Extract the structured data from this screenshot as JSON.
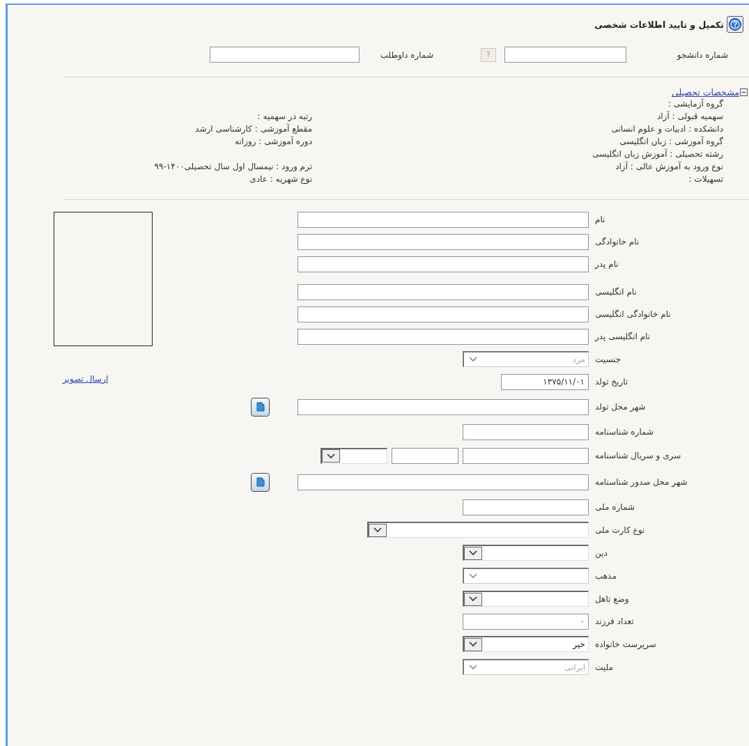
{
  "header": {
    "title": "تکمیل و تایید اطلاعات شخصی"
  },
  "id_fields": [
    {
      "label": "شماره دانشجو",
      "help": "?"
    },
    {
      "label": "شماره داوطلب"
    }
  ],
  "academic": {
    "title": "مشخصات تحصیلی",
    "expanded": true,
    "rows": [
      {
        "right": "گروه آزمایشی :"
      },
      {
        "right": "سهمیه قبولی : آزاد",
        "left": "رتبه در سهمیه :"
      },
      {
        "right": "دانشکده : ادبیات و علوم انسانی",
        "left": "مقطع آموزشی : کارشناسی ارشد"
      },
      {
        "right": "گروه آموزشی : زبان انگلیسی",
        "left": "دوره آموزشی : روزانه"
      },
      {
        "right": "رشته تحصیلی : آموزش زبان انگلیسی"
      },
      {
        "right": "نوع ورود به آموزش عالی : آزاد",
        "left": "ترم ورود : نیمسال اول سال تحصیلی۱۴۰۰-۹۹"
      },
      {
        "right": "تسهیلات :",
        "left": "نوع شهریه : عادی"
      }
    ]
  },
  "photo": {
    "link": "ارسال تصویر"
  },
  "field_groups": [
    {
      "fields": [
        {
          "label": "نام",
          "kind": "long-text"
        },
        {
          "label": "نام خانوادگی",
          "kind": "long-text"
        },
        {
          "label": "نام پدر",
          "kind": "long-text"
        }
      ]
    },
    {
      "fields": [
        {
          "label": "نام انگلیسی",
          "kind": "long-text"
        },
        {
          "label": "نام خانوادگی انگلیسی",
          "kind": "long-text"
        },
        {
          "label": "نام انگلیسی پدر",
          "kind": "long-text"
        },
        {
          "label": "جنسیت",
          "kind": "short-select",
          "value": "مرد",
          "disabled": true
        },
        {
          "label": "تاریخ تولد",
          "kind": "date",
          "value": "۱۳۷۵/۱۱/۰۱"
        },
        {
          "label": "شهر محل تولد",
          "kind": "lookup"
        },
        {
          "label": "شماره شناسنامه",
          "kind": "short-text"
        },
        {
          "label": "سری و سریال شناسنامه",
          "kind": "serial"
        },
        {
          "label": "شهر محل صدور شناسنامه",
          "kind": "lookup"
        },
        {
          "label": "شماره ملی",
          "kind": "short-text"
        },
        {
          "label": "نوع کارت ملی",
          "kind": "long-select",
          "disabled": false
        },
        {
          "label": "دین",
          "kind": "short-select",
          "disabled": false
        },
        {
          "label": "مذهب",
          "kind": "short-select",
          "disabled": true
        },
        {
          "label": "وضع تاهل",
          "kind": "short-select",
          "disabled": false
        },
        {
          "label": "تعداد فرزند",
          "kind": "short-text",
          "value": "۰"
        },
        {
          "label": "سرپرست خانواده",
          "kind": "short-select",
          "value": "خیر",
          "disabled": false
        },
        {
          "label": "ملیت",
          "kind": "short-select",
          "value": "ایرانی",
          "disabled": true
        }
      ]
    }
  ]
}
